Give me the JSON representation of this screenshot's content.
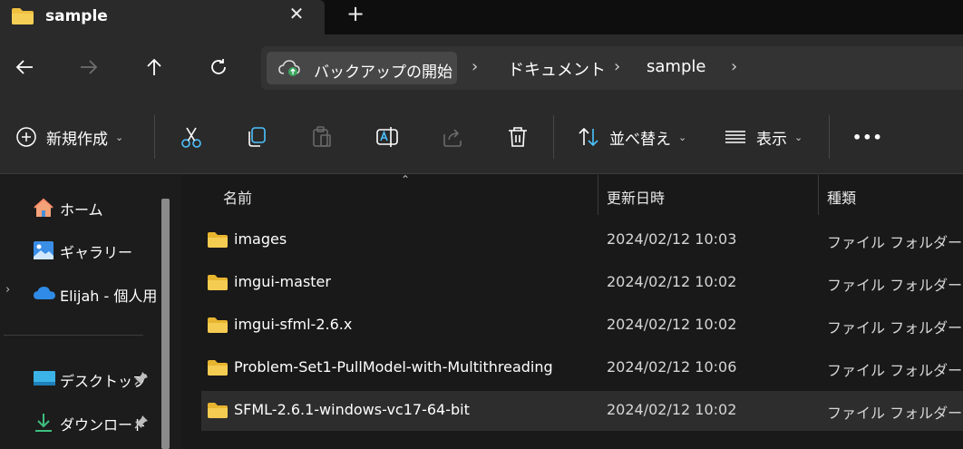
{
  "tab": {
    "title": "sample",
    "close": "✕",
    "new": "+"
  },
  "address": {
    "backup_label": "バックアップの開始",
    "crumbs": [
      "ドキュメント",
      "sample"
    ],
    "separator": "›"
  },
  "toolbar": {
    "new_label": "新規作成",
    "sort_label": "並べ替え",
    "view_label": "表示",
    "more_label": "•••",
    "chevron": "⌄"
  },
  "sidebar": {
    "items": [
      {
        "label": "ホーム",
        "icon": "home-icon"
      },
      {
        "label": "ギャラリー",
        "icon": "gallery-icon"
      },
      {
        "label": "Elijah - 個人用",
        "icon": "onedrive-cloud-icon",
        "expand": "›"
      },
      {
        "label": "デスクトップ",
        "icon": "desktop-icon"
      },
      {
        "label": "ダウンロード",
        "icon": "download-icon"
      }
    ]
  },
  "columns": {
    "name": "名前",
    "modified": "更新日時",
    "type": "種類",
    "sort_caret": "⌃"
  },
  "files": [
    {
      "name": "images",
      "modified": "2024/02/12 10:03",
      "type": "ファイル フォルダー"
    },
    {
      "name": "imgui-master",
      "modified": "2024/02/12 10:02",
      "type": "ファイル フォルダー"
    },
    {
      "name": "imgui-sfml-2.6.x",
      "modified": "2024/02/12 10:02",
      "type": "ファイル フォルダー"
    },
    {
      "name": "Problem-Set1-PullModel-with-Multithreading",
      "modified": "2024/02/12 10:06",
      "type": "ファイル フォルダー"
    },
    {
      "name": "SFML-2.6.1-windows-vc17-64-bit",
      "modified": "2024/02/12 10:02",
      "type": "ファイル フォルダー"
    }
  ],
  "colors": {
    "folder": "#f0c040",
    "accent": "#4cc2ff",
    "background": "#191919",
    "bar": "#2a2a2a"
  }
}
